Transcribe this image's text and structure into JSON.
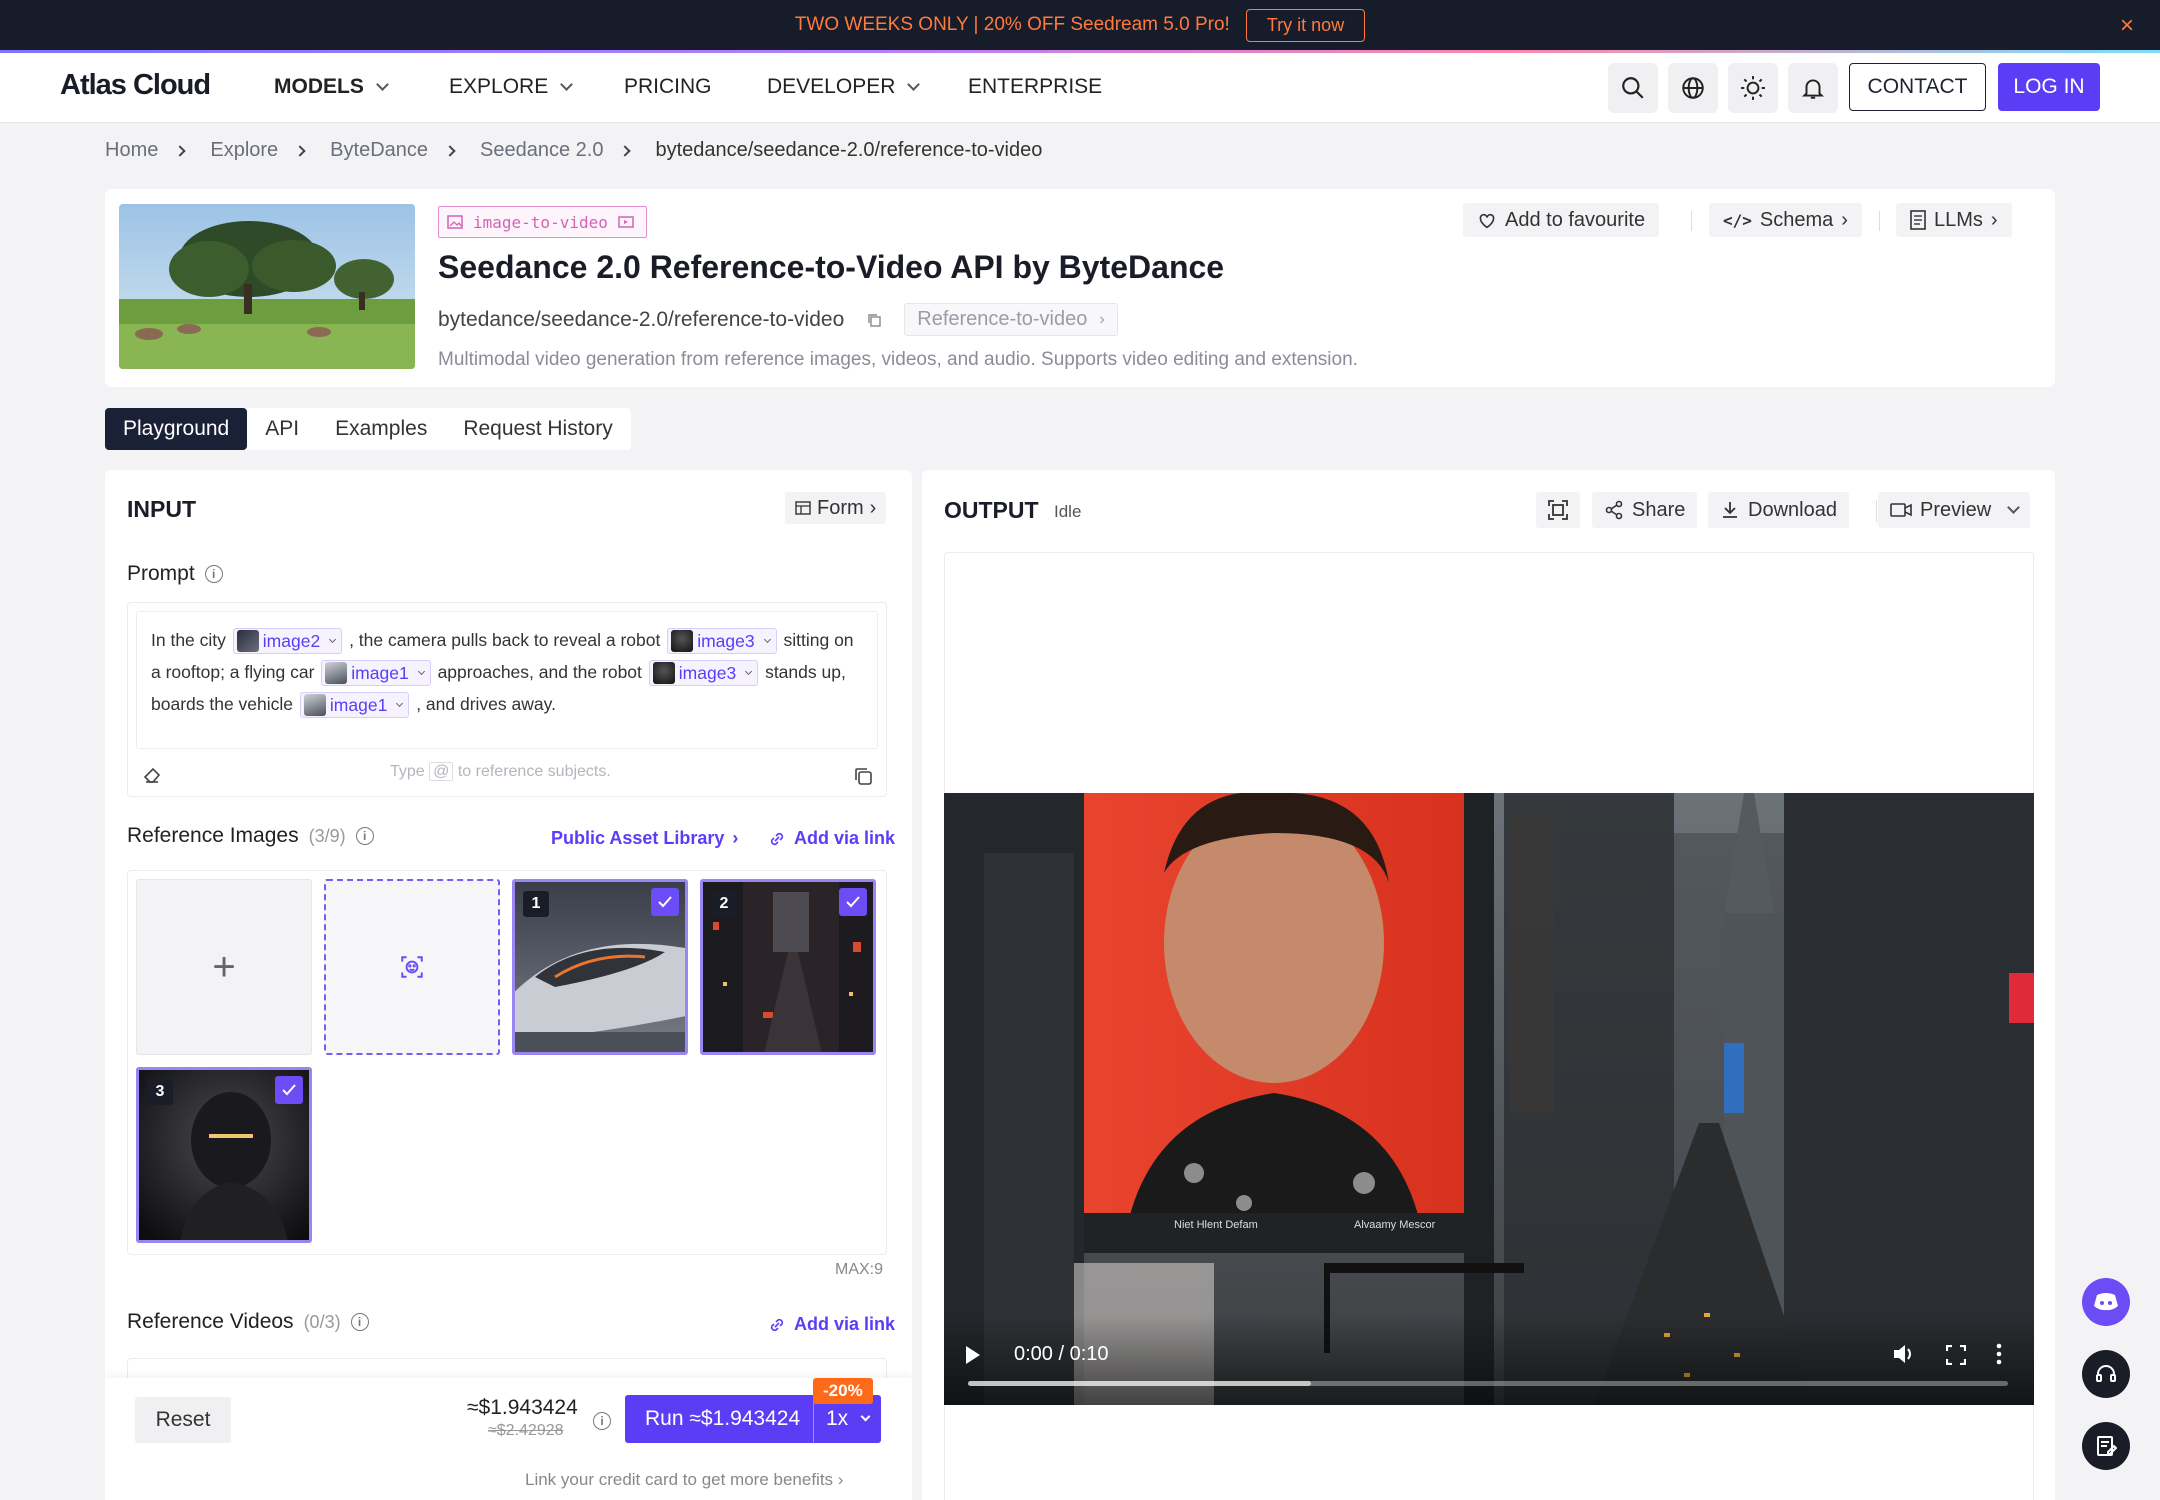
{
  "promo": {
    "text": "TWO WEEKS ONLY | 20% OFF Seedream 5.0 Pro!",
    "cta": "Try it now",
    "close": "×"
  },
  "nav": {
    "logo": "Atlas Cloud",
    "items": [
      "MODELS",
      "EXPLORE",
      "PRICING",
      "DEVELOPER",
      "ENTERPRISE"
    ],
    "contact": "CONTACT",
    "login": "LOG IN"
  },
  "breadcrumb": [
    "Home",
    "Explore",
    "ByteDance",
    "Seedance 2.0",
    "bytedance/seedance-2.0/reference-to-video"
  ],
  "model": {
    "tag": "image-to-video",
    "title": "Seedance 2.0 Reference-to-Video API by ByteDance",
    "slug": "bytedance/seedance-2.0/reference-to-video",
    "variant": "Reference-to-video",
    "description": "Multimodal video generation from reference images, videos, and audio. Supports video editing and extension.",
    "favourite": "Add to favourite",
    "schema": "Schema",
    "llms": "LLMs"
  },
  "tabs": [
    "Playground",
    "API",
    "Examples",
    "Request History"
  ],
  "input": {
    "heading": "INPUT",
    "form": "Form",
    "prompt_label": "Prompt",
    "prompt": {
      "t1": "In the city",
      "c1": "image2",
      "t2": ", the camera pulls back to reveal a robot",
      "c2": "image3",
      "t3": "sitting on a rooftop; a flying car",
      "c3": "image1",
      "t4": "approaches, and the robot",
      "c4": "image3",
      "t5": "stands up, boards the vehicle",
      "c5": "image1",
      "t6": ", and drives away."
    },
    "hint_a": "Type",
    "hint_at": "@",
    "hint_b": "to reference subjects.",
    "ref_images_label": "Reference Images",
    "ref_images_count": "(3/9)",
    "public_library": "Public Asset Library",
    "add_via_link": "Add via link",
    "add_slot": "+",
    "image_numbers": [
      "1",
      "2",
      "3"
    ],
    "max": "MAX:9",
    "ref_videos_label": "Reference Videos",
    "ref_videos_count": "(0/3)"
  },
  "footer": {
    "reset": "Reset",
    "price": "≈$1.943424",
    "old_price": "≈$2.42928",
    "run": "Run ≈$1.943424",
    "multiplier": "1x",
    "discount": "-20%",
    "credit_link": "Link your credit card to get more benefits"
  },
  "output": {
    "heading": "OUTPUT",
    "status": "Idle",
    "share": "Share",
    "download": "Download",
    "preview": "Preview",
    "video_time": "0:00 / 0:10",
    "video_progress": 0.33
  },
  "colors": {
    "accent": "#5b3df5",
    "promo_bg": "#171c2b",
    "promo_text": "#ff7a3c",
    "discount": "#ff6a1a"
  }
}
